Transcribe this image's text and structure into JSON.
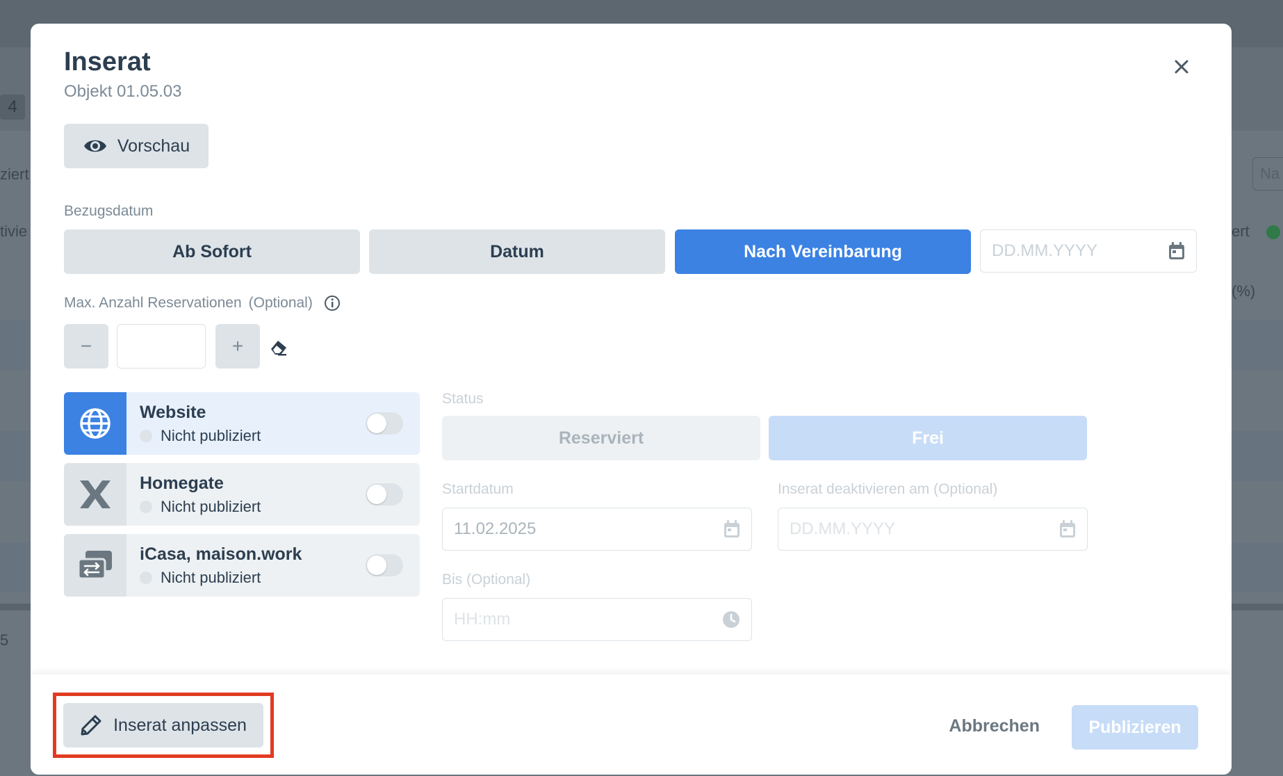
{
  "background": {
    "badge": "4",
    "fragments": [
      "ziert",
      "tivie",
      "ert",
      "(%)",
      "Na",
      "5"
    ]
  },
  "modal": {
    "title": "Inserat",
    "subtitle": "Objekt 01.05.03",
    "preview_label": "Vorschau",
    "bezugsdatum": {
      "label": "Bezugsdatum",
      "options": [
        "Ab Sofort",
        "Datum",
        "Nach Vereinbarung"
      ],
      "selected": "Nach Vereinbarung",
      "date_placeholder": "DD.MM.YYYY"
    },
    "max_reservations": {
      "label": "Max. Anzahl Reservationen",
      "optional": "(Optional)",
      "minus": "−",
      "plus": "+",
      "value": ""
    },
    "channels": [
      {
        "name": "Website",
        "status": "Nicht publiziert",
        "active": true,
        "enabled": false
      },
      {
        "name": "Homegate",
        "status": "Nicht publiziert",
        "active": false,
        "enabled": false
      },
      {
        "name": "iCasa, maison.work",
        "status": "Nicht publiziert",
        "active": false,
        "enabled": false
      }
    ],
    "status": {
      "label": "Status",
      "options": [
        "Reserviert",
        "Frei"
      ],
      "selected": "Frei"
    },
    "start_date": {
      "label": "Startdatum",
      "value": "11.02.2025"
    },
    "deactivate_date": {
      "label": "Inserat deaktivieren am (Optional)",
      "placeholder": "DD.MM.YYYY"
    },
    "until_time": {
      "label": "Bis (Optional)",
      "placeholder": "HH:mm"
    },
    "footer": {
      "edit_label": "Inserat anpassen",
      "cancel_label": "Abbrechen",
      "publish_label": "Publizieren"
    }
  },
  "colors": {
    "accent": "#3b82e3",
    "accent_disabled": "#c7dcf7",
    "highlight": "#e23b22"
  }
}
